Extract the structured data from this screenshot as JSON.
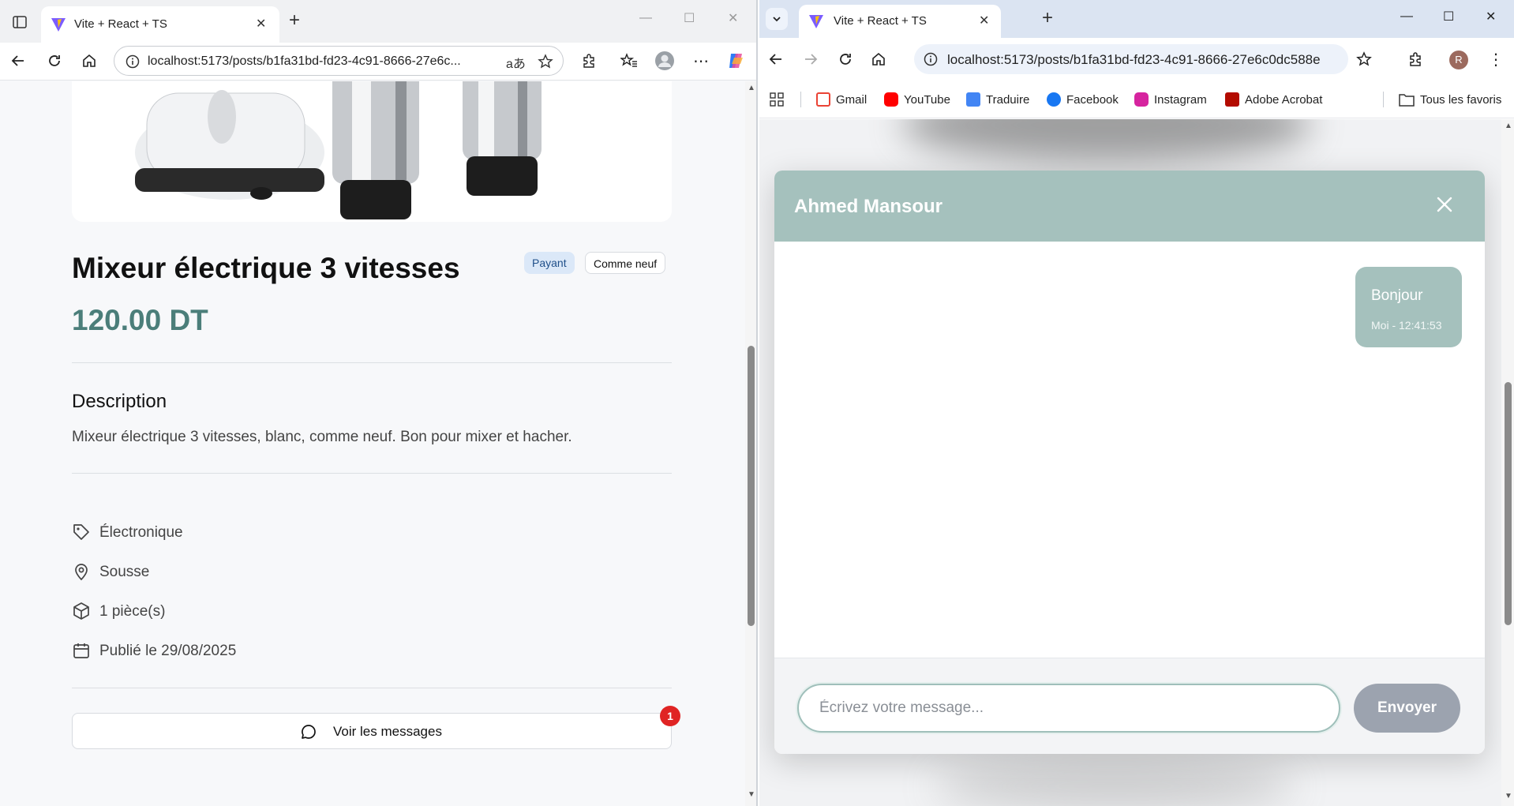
{
  "left_browser": {
    "tab": {
      "title": "Vite + React + TS",
      "favicon": "vite-icon"
    },
    "address": {
      "url": "localhost:5173/posts/b1fa31bd-fd23-4c91-8666-27e6c...",
      "read_aloud": "aあ"
    },
    "toolbar_icons": [
      "back-icon",
      "refresh-icon",
      "home-icon",
      "star-icon",
      "extensions-icon",
      "favorites-icon",
      "profile-icon",
      "more-icon",
      "copilot-icon"
    ]
  },
  "product": {
    "title": "Mixeur électrique 3 vitesses",
    "badges": {
      "pricing": "Payant",
      "condition": "Comme neuf"
    },
    "price": "120.00 DT",
    "description_heading": "Description",
    "description": "Mixeur électrique 3 vitesses, blanc, comme neuf. Bon pour mixer et hacher.",
    "meta": {
      "category": "Électronique",
      "location": "Sousse",
      "quantity": "1 pièce(s)",
      "published": "Publié le 29/08/2025"
    },
    "messages_button": "Voir les messages",
    "notification_count": "1"
  },
  "right_browser": {
    "tab": {
      "title": "Vite + React + TS",
      "favicon": "vite-icon"
    },
    "address": {
      "url": "localhost:5173/posts/b1fa31bd-fd23-4c91-8666-27e6c0dc588e"
    },
    "avatar_letter": "R",
    "bookmarks": [
      "Gmail",
      "YouTube",
      "Traduire",
      "Facebook",
      "Instagram",
      "Adobe Acrobat"
    ],
    "all_bookmarks": "Tous les favoris"
  },
  "chat": {
    "contact_name": "Ahmed Mansour",
    "messages": [
      {
        "text": "Bonjour",
        "meta": "Moi - 12:41:53"
      }
    ],
    "input_placeholder": "Écrivez votre message...",
    "send_label": "Envoyer"
  },
  "colors": {
    "accent_teal": "#a5c1bd",
    "price_teal": "#4b7e7a",
    "badge_blue_bg": "#dbe8f8",
    "notification_red": "#e02424",
    "send_disabled": "#9ca3af"
  }
}
